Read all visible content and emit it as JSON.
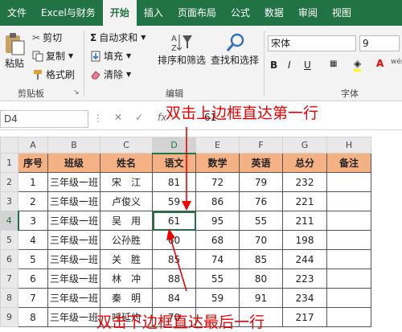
{
  "tabs": [
    "文件",
    "Excel与财务",
    "开始",
    "插入",
    "页面布局",
    "公式",
    "数据",
    "审阅",
    "视图"
  ],
  "active_tab": 2,
  "clipboard": {
    "paste": "粘贴",
    "cut": "剪切",
    "copy": "复制",
    "format_painter": "格式刷",
    "group_label": "剪贴板"
  },
  "editing": {
    "autosum": "自动求和",
    "fill": "填充",
    "clear": "清除",
    "sort_filter": "排序和筛选",
    "find_select": "查找和选择",
    "group_label": "编辑"
  },
  "font": {
    "name": "宋体",
    "size": "9",
    "group_label": "字体",
    "bold": "B",
    "italic": "I",
    "underline": "U",
    "grow": "A",
    "shrink": "A",
    "color_a": "A",
    "wen": "wén"
  },
  "formula_bar": {
    "name_box": "D4",
    "fx": "fx",
    "value": "61"
  },
  "columns": [
    "A",
    "B",
    "C",
    "D",
    "E",
    "F",
    "G",
    "H"
  ],
  "headers": [
    "序号",
    "班级",
    "姓名",
    "语文",
    "数学",
    "英语",
    "总分",
    "备注"
  ],
  "rows": [
    [
      "1",
      "三年级一班",
      "宋　江",
      "81",
      "72",
      "79",
      "232",
      ""
    ],
    [
      "2",
      "三年级一班",
      "卢俊义",
      "59",
      "86",
      "76",
      "221",
      ""
    ],
    [
      "3",
      "三年级一班",
      "吴　用",
      "61",
      "95",
      "55",
      "211",
      ""
    ],
    [
      "4",
      "三年级一班",
      "公孙胜",
      "60",
      "68",
      "70",
      "198",
      ""
    ],
    [
      "5",
      "三年级一班",
      "关　胜",
      "85",
      "74",
      "85",
      "244",
      ""
    ],
    [
      "6",
      "三年级一班",
      "林　冲",
      "88",
      "55",
      "80",
      "223",
      ""
    ],
    [
      "7",
      "三年级一班",
      "秦　明",
      "84",
      "59",
      "91",
      "234",
      ""
    ],
    [
      "8",
      "三年级一班",
      "呼延灼",
      "70",
      "",
      "",
      "217",
      ""
    ]
  ],
  "annotations": {
    "top": "双击上边框直达第一行",
    "bottom": "双击下边框直达最后一行"
  },
  "colors": {
    "excel_green": "#217346",
    "header_fill": "#f4b183",
    "annotation": "#ee0000"
  }
}
